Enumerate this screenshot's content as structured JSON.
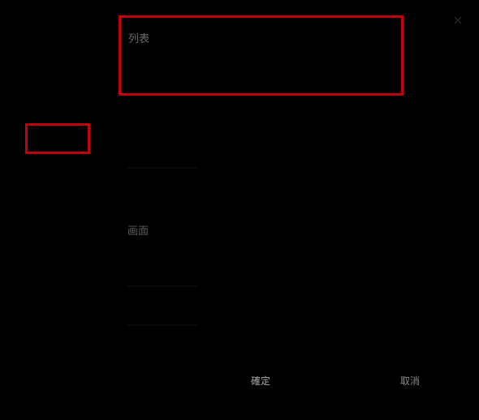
{
  "dialog": {
    "list_label": "列表",
    "screen_label": "画面"
  },
  "footer": {
    "ok_label": "確定",
    "cancel_label": "取消"
  },
  "icons": {
    "close": "close-icon"
  },
  "colors": {
    "background": "#000000",
    "highlight": "#c0000c",
    "text": "#6e6e6e"
  }
}
